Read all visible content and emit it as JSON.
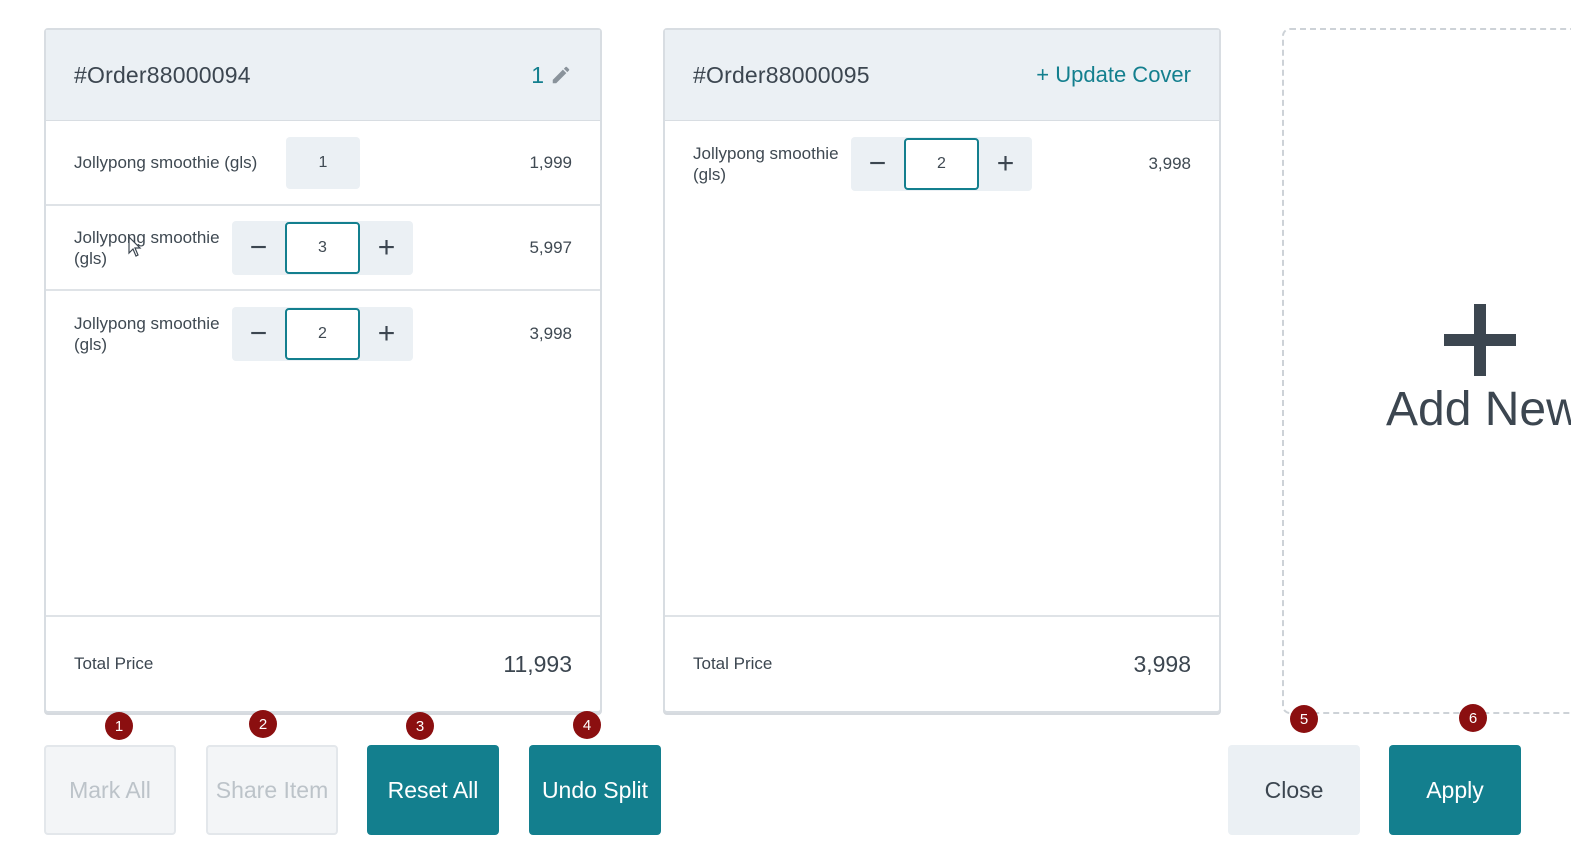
{
  "colors": {
    "accent": "#137f8e",
    "badge": "#8b0f10",
    "header_bg": "#ebf0f4"
  },
  "orders": [
    {
      "id": "#Order88000094",
      "cover_count": "1",
      "cover_icon": "pencil-icon",
      "items": [
        {
          "name": "Jollypong smoothie (gls)",
          "qty": "1",
          "price": "1,999"
        },
        {
          "name": "Jollypong smoothie (gls)",
          "qty": "3",
          "price": "5,997"
        },
        {
          "name": "Jollypong smoothie (gls)",
          "qty": "2",
          "price": "3,998"
        }
      ],
      "total_label": "Total Price",
      "total": "11,993"
    },
    {
      "id": "#Order88000095",
      "update_cover": "+ Update Cover",
      "items": [
        {
          "name": "Jollypong smoothie (gls)",
          "qty": "2",
          "price": "3,998"
        }
      ],
      "total_label": "Total Price",
      "total": "3,998"
    }
  ],
  "add_new": {
    "label": "Add New",
    "icon": "plus-icon"
  },
  "stepper": {
    "minus": "−",
    "plus": "+"
  },
  "buttons": {
    "mark_all": "Mark All",
    "share_item": "Share Item",
    "reset_all": "Reset All",
    "undo_split": "Undo Split",
    "close": "Close",
    "apply": "Apply"
  },
  "badges": [
    "1",
    "2",
    "3",
    "4",
    "5",
    "6"
  ]
}
